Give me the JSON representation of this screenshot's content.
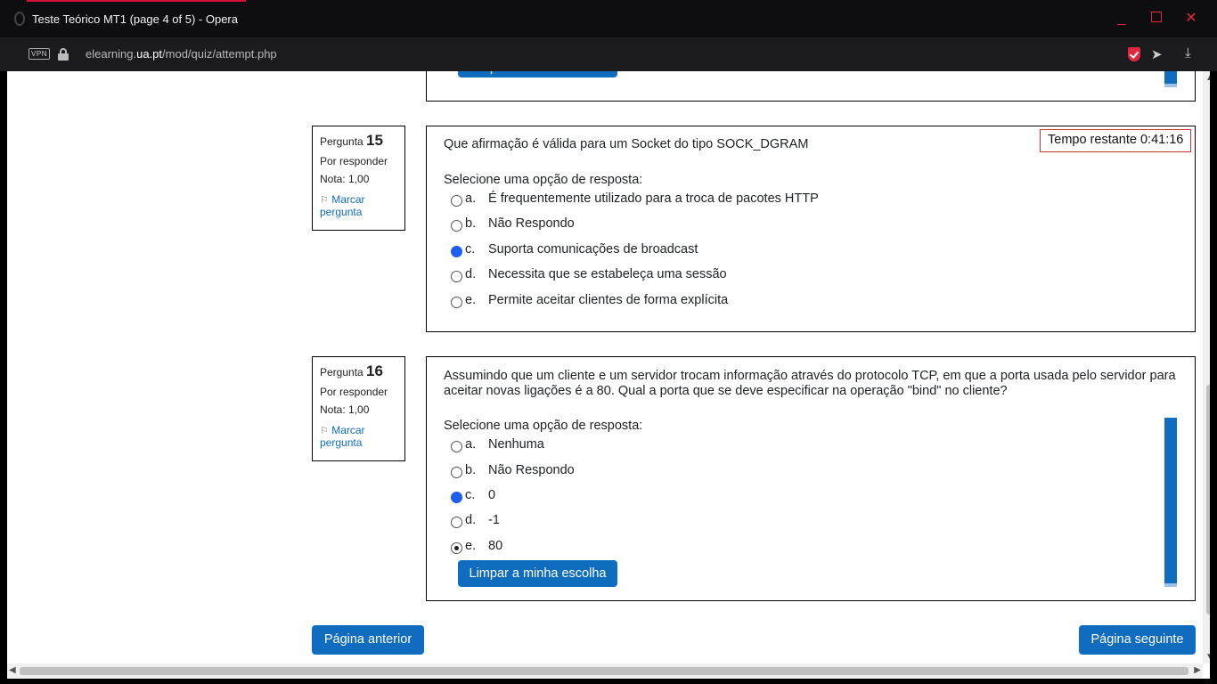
{
  "window": {
    "title": "Teste Teórico MT1 (page 4 of 5) - Opera",
    "minimize": "_",
    "close": "✕"
  },
  "addressbar": {
    "vpn_label": "VPN",
    "url_prefix": "elearning.",
    "url_domain": "ua.pt",
    "url_path": "/mod/quiz/attempt.php"
  },
  "quiz": {
    "clear_label": "Limpar a minha escolha",
    "timer": "Tempo restante 0:41:16",
    "questions": [
      {
        "label": "Pergunta",
        "number": "15",
        "status": "Por responder",
        "grade": "Nota: 1,00",
        "flag": "Marcar pergunta",
        "text": "Que afirmação é válida para um Socket do tipo SOCK_DGRAM",
        "prompt": "Selecione uma opção de resposta:",
        "options": [
          {
            "letter": "a.",
            "text": "É frequentemente utilizado para a troca de pacotes HTTP"
          },
          {
            "letter": "b.",
            "text": "Não Respondo"
          },
          {
            "letter": "c.",
            "text": "Suporta comunicações de broadcast"
          },
          {
            "letter": "d.",
            "text": "Necessita que se estabeleça uma sessão"
          },
          {
            "letter": "e.",
            "text": "Permite aceitar clientes de forma explícita"
          }
        ]
      },
      {
        "label": "Pergunta",
        "number": "16",
        "status": "Por responder",
        "grade": "Nota: 1,00",
        "flag": "Marcar pergunta",
        "text": "Assumindo que um cliente e um servidor trocam informação através do protocolo TCP, em que a porta usada pelo servidor para aceitar novas ligações é a 80. Qual a porta que se deve especificar na operação \"bind\" no cliente?",
        "prompt": "Selecione uma opção de resposta:",
        "options": [
          {
            "letter": "a.",
            "text": "Nenhuma"
          },
          {
            "letter": "b.",
            "text": "Não Respondo"
          },
          {
            "letter": "c.",
            "text": "0"
          },
          {
            "letter": "d.",
            "text": "-1"
          },
          {
            "letter": "e.",
            "text": "80"
          }
        ]
      }
    ],
    "prev_button": "Página anterior",
    "next_button": "Página seguinte"
  }
}
